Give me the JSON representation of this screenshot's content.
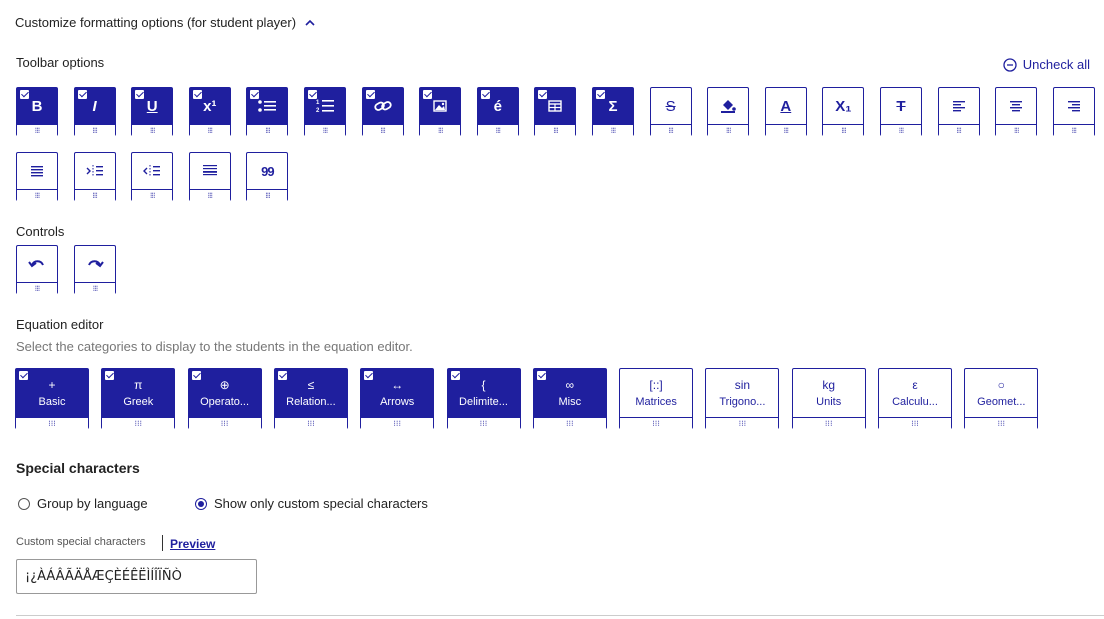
{
  "header": {
    "title": "Customize formatting options (for student player)"
  },
  "toolbar": {
    "label": "Toolbar options",
    "uncheck_all": "Uncheck all",
    "buttons": [
      {
        "name": "bold",
        "glyph": "B",
        "checked": true
      },
      {
        "name": "italic",
        "glyph": "I",
        "checked": true
      },
      {
        "name": "underline",
        "glyph": "U",
        "checked": true
      },
      {
        "name": "superscript",
        "glyph": "x¹",
        "checked": true
      },
      {
        "name": "bullet-list",
        "glyph": "",
        "checked": true
      },
      {
        "name": "numbered-list",
        "glyph": "",
        "checked": true
      },
      {
        "name": "link",
        "glyph": "",
        "checked": true
      },
      {
        "name": "image",
        "glyph": "",
        "checked": true
      },
      {
        "name": "special-char",
        "glyph": "é",
        "checked": true
      },
      {
        "name": "table",
        "glyph": "",
        "checked": true
      },
      {
        "name": "equation",
        "glyph": "Σ",
        "checked": true
      },
      {
        "name": "strikethrough",
        "glyph": "S",
        "checked": false
      },
      {
        "name": "fill-color",
        "glyph": "",
        "checked": false
      },
      {
        "name": "text-color",
        "glyph": "A",
        "checked": false
      },
      {
        "name": "subscript",
        "glyph": "X₁",
        "checked": false
      },
      {
        "name": "clear-format",
        "glyph": "T",
        "checked": false
      },
      {
        "name": "align-left",
        "glyph": "",
        "checked": false
      },
      {
        "name": "align-center",
        "glyph": "",
        "checked": false
      },
      {
        "name": "align-right",
        "glyph": "",
        "checked": false
      },
      {
        "name": "align-justify",
        "glyph": "",
        "checked": false
      },
      {
        "name": "indent",
        "glyph": "",
        "checked": false
      },
      {
        "name": "outdent",
        "glyph": "",
        "checked": false
      },
      {
        "name": "horizontal-rule",
        "glyph": "",
        "checked": false
      },
      {
        "name": "blockquote",
        "glyph": "99",
        "checked": false
      }
    ]
  },
  "controls": {
    "label": "Controls",
    "buttons": [
      {
        "name": "undo"
      },
      {
        "name": "redo"
      }
    ]
  },
  "equation_editor": {
    "label": "Equation editor",
    "description": "Select the categories to display to the students in the equation editor.",
    "categories": [
      {
        "name": "Basic",
        "symbol": "+",
        "checked": true
      },
      {
        "name": "Greek",
        "symbol": "π",
        "checked": true
      },
      {
        "name": "Operato...",
        "symbol": "⊕",
        "checked": true
      },
      {
        "name": "Relation...",
        "symbol": "≤",
        "checked": true
      },
      {
        "name": "Arrows",
        "symbol": "↔",
        "checked": true
      },
      {
        "name": "Delimite...",
        "symbol": "{",
        "checked": true
      },
      {
        "name": "Misc",
        "symbol": "∞",
        "checked": true
      },
      {
        "name": "Matrices",
        "symbol": "[::]",
        "checked": false
      },
      {
        "name": "Trigono...",
        "symbol": "sin",
        "checked": false
      },
      {
        "name": "Units",
        "symbol": "kg",
        "checked": false
      },
      {
        "name": "Calculu...",
        "symbol": "ε",
        "checked": false
      },
      {
        "name": "Geomet...",
        "symbol": "○",
        "checked": false
      }
    ]
  },
  "special_characters": {
    "label": "Special characters",
    "option_group": "Group by language",
    "option_custom": "Show only custom special characters",
    "custom_label": "Custom special characters",
    "preview": "Preview",
    "value": "¡¿ÀÁÂÃÄÅÆÇÈÉÊËÌÍÎÏÑÒ"
  },
  "colors": {
    "accent": "#1f1f9e"
  }
}
